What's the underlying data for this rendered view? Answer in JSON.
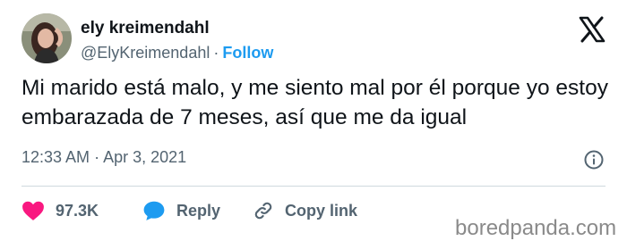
{
  "user": {
    "display_name": "ely kreimendahl",
    "handle": "@ElyKreimendahl",
    "separator": "·",
    "follow_label": "Follow"
  },
  "tweet": {
    "text": "Mi marido está malo, y me siento mal por él porque yo estoy embarazada de 7 meses, así que me da igual",
    "time": "12:33 AM",
    "date_separator": "·",
    "date": "Apr 3, 2021"
  },
  "actions": {
    "likes_count": "97.3K",
    "reply_label": "Reply",
    "copy_link_label": "Copy link"
  },
  "watermark": "boredpanda.com",
  "icons": {
    "brand": "x-logo-icon",
    "info": "info-icon",
    "like": "heart-icon",
    "reply": "reply-bubble-icon",
    "copy": "link-icon"
  },
  "colors": {
    "accent": "#1d9bf0",
    "like": "#f91880",
    "text_primary": "#0f1419",
    "text_secondary": "#536471"
  }
}
